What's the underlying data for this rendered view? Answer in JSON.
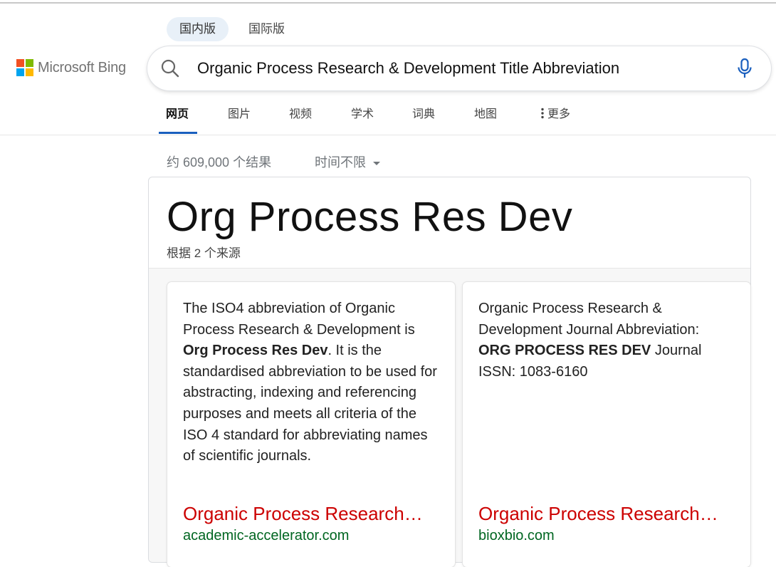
{
  "region_tabs": [
    {
      "label": "国内版",
      "active": true
    },
    {
      "label": "国际版",
      "active": false
    }
  ],
  "logo": {
    "text": "Microsoft Bing",
    "colors": [
      "#f25022",
      "#7fba00",
      "#00a4ef",
      "#ffb900"
    ]
  },
  "search": {
    "query": "Organic Process Research & Development Title Abbreviation"
  },
  "nav": {
    "items": [
      "网页",
      "图片",
      "视频",
      "学术",
      "词典",
      "地图"
    ],
    "more_label": "更多",
    "active_color": "#1a5fbe"
  },
  "results": {
    "count_text": "约 609,000 个结果",
    "time_filter": "时间不限"
  },
  "answer": {
    "title": "Org Process Res Dev",
    "subtitle": "根据 2 个来源",
    "sources": [
      {
        "text_before": "The ISO4 abbreviation of Organic Process Research & Development is ",
        "text_bold": "Org Process Res Dev",
        "text_after": ". It is the standardised abbreviation to be used for abstracting, indexing and referencing purposes and meets all criteria of the ISO 4 standard for abbreviating names of scientific journals.",
        "link_title": "Organic Process Research & Development Abbreviation",
        "domain": "academic-accelerator.com"
      },
      {
        "text_before": "Organic Process Research & Development Journal Abbreviation: ",
        "text_bold": "ORG PROCESS RES DEV",
        "text_after": " Journal ISSN: 1083-6160",
        "link_title": "Organic Process Research & Development Journal Abbreviation",
        "domain": "bioxbio.com"
      }
    ]
  }
}
